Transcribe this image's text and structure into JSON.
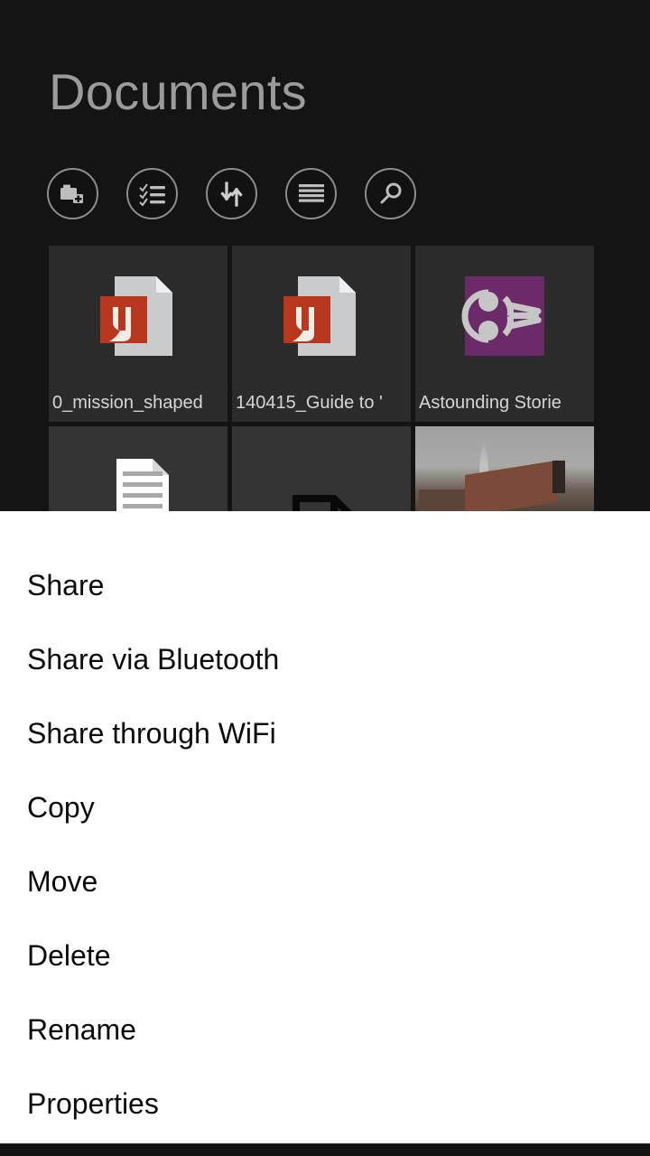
{
  "app": {
    "title": "Documents",
    "toolbar": [
      {
        "name": "new-folder-icon",
        "label": "New folder"
      },
      {
        "name": "select-list-icon",
        "label": "Select"
      },
      {
        "name": "sort-icon",
        "label": "Sort"
      },
      {
        "name": "view-list-icon",
        "label": "View"
      },
      {
        "name": "search-icon",
        "label": "Search"
      }
    ],
    "files": [
      {
        "name": "0_mission_shaped",
        "icon": "word-document-icon",
        "accent": "#b7371f"
      },
      {
        "name": "140415_Guide to '",
        "icon": "word-document-icon",
        "accent": "#b7371f"
      },
      {
        "name": "Astounding Storie",
        "icon": "epub-book-icon",
        "accent": "#6b2a68"
      },
      {
        "name": "",
        "icon": "text-document-icon",
        "accent": "#2a63b0"
      },
      {
        "name": "",
        "icon": "outline-document-icon",
        "accent": "#0a0a0a"
      },
      {
        "name": "",
        "icon": "photo-thumbnail",
        "accent": "#8e8b85"
      }
    ]
  },
  "context_menu": {
    "items": [
      {
        "label": "Share"
      },
      {
        "label": "Share via Bluetooth"
      },
      {
        "label": "Share through WiFi"
      },
      {
        "label": "Copy"
      },
      {
        "label": "Move"
      },
      {
        "label": "Delete"
      },
      {
        "label": "Rename"
      },
      {
        "label": "Properties"
      }
    ]
  },
  "colors": {
    "background": "#141414",
    "tile": "#2b2b2b",
    "title_text": "#9b9b9b",
    "sheet_background": "#ffffff",
    "sheet_text": "#0a0a0a"
  }
}
